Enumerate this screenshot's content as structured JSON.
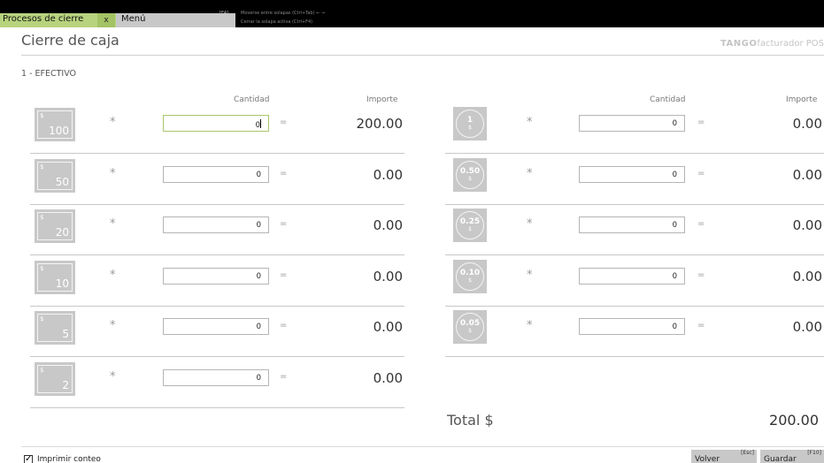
{
  "tabs": {
    "active_label": "Procesos de cierre",
    "close_glyph": "x",
    "menu_label": "Menú",
    "menu_key": "[F4]",
    "hint_switch": "Moverse entre solapas (Ctrl+Tab) ← →",
    "hint_close": "Cerrar la solapa activa (Ctrl+F4)"
  },
  "header": {
    "title": "Cierre de caja",
    "brand_logo": "TANGO",
    "brand_text": "facturador POS"
  },
  "section": {
    "title": "1 - EFECTIVO",
    "col_cantidad": "Cantidad",
    "col_importe": "Importe",
    "times": "*",
    "equals": "="
  },
  "bills": [
    {
      "symbol": "$",
      "value": "100",
      "qty": "0",
      "amount": "200.00"
    },
    {
      "symbol": "$",
      "value": "50",
      "qty": "0",
      "amount": "0.00"
    },
    {
      "symbol": "$",
      "value": "20",
      "qty": "0",
      "amount": "0.00"
    },
    {
      "symbol": "$",
      "value": "10",
      "qty": "0",
      "amount": "0.00"
    },
    {
      "symbol": "$",
      "value": "5",
      "qty": "0",
      "amount": "0.00"
    },
    {
      "symbol": "$",
      "value": "2",
      "qty": "0",
      "amount": "0.00"
    }
  ],
  "coins": [
    {
      "symbol": "$",
      "value": "1",
      "qty": "0",
      "amount": "0.00"
    },
    {
      "symbol": "$",
      "value": "0.50",
      "qty": "0",
      "amount": "0.00"
    },
    {
      "symbol": "$",
      "value": "0.25",
      "qty": "0",
      "amount": "0.00"
    },
    {
      "symbol": "$",
      "value": "0.10",
      "qty": "0",
      "amount": "0.00"
    },
    {
      "symbol": "$",
      "value": "0.05",
      "qty": "0",
      "amount": "0.00"
    }
  ],
  "total": {
    "label": "Total $",
    "value": "200.00"
  },
  "footer": {
    "print_checked": true,
    "print_check_glyph": "✓",
    "print_label": "Imprimir conteo",
    "back_label": "Volver",
    "back_key": "[Esc]",
    "save_label": "Guardar",
    "save_key": "[F10]"
  },
  "colors": {
    "active_tab": "#b7d37e",
    "focus_border": "#a8c66c",
    "icon_bg": "#c8c8c8"
  }
}
